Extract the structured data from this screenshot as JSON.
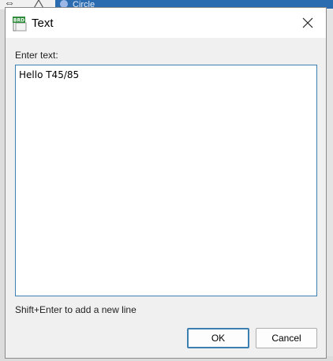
{
  "background": {
    "selected_item_label": "Circle"
  },
  "dialog": {
    "title": "Text",
    "icon": "brd-app-icon",
    "icon_text": "BRD",
    "close_icon": "close-icon",
    "prompt_label": "Enter text:",
    "text_value": "Hello T45/85",
    "hint": "Shift+Enter to add a new line",
    "ok_label": "OK",
    "cancel_label": "Cancel"
  },
  "colors": {
    "accent": "#3c7fb1",
    "dialog_bg": "#f0f0f0",
    "icon_green": "#2e8b3a"
  }
}
